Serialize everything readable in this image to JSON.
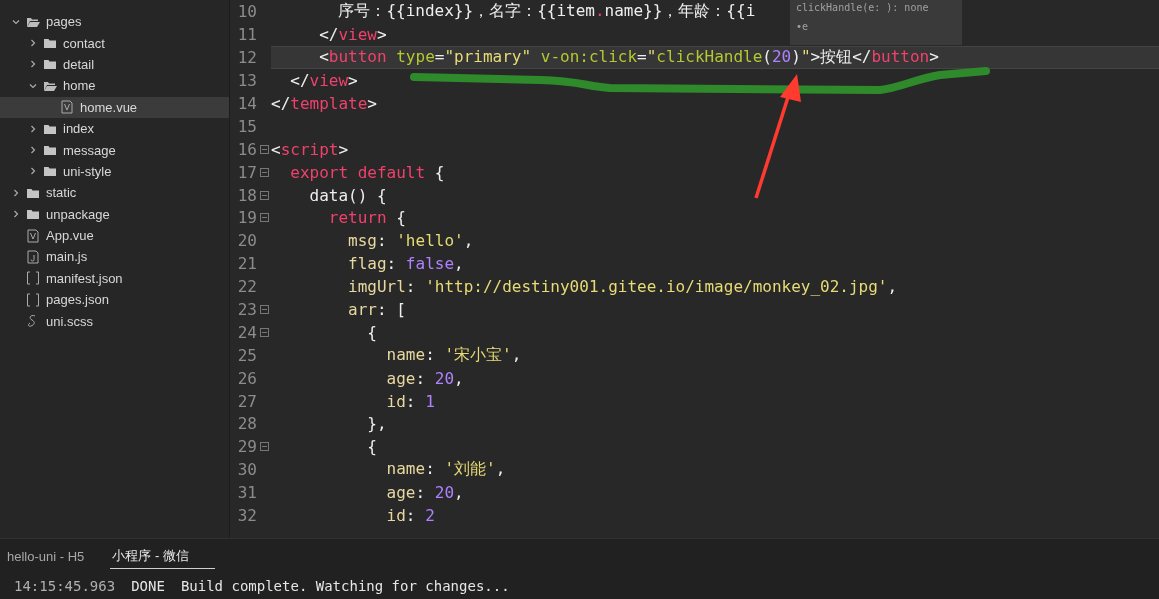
{
  "sidebar": {
    "tree": [
      {
        "name": "pages",
        "kind": "folder",
        "expanded": true,
        "selected": false,
        "children": [
          {
            "name": "contact",
            "kind": "folder",
            "expanded": false,
            "selected": false
          },
          {
            "name": "detail",
            "kind": "folder",
            "expanded": false,
            "selected": false
          },
          {
            "name": "home",
            "kind": "folder",
            "expanded": true,
            "selected": false,
            "children": [
              {
                "name": "home.vue",
                "kind": "vue",
                "selected": true
              }
            ]
          },
          {
            "name": "index",
            "kind": "folder",
            "expanded": false,
            "selected": false
          },
          {
            "name": "message",
            "kind": "folder",
            "expanded": false,
            "selected": false
          },
          {
            "name": "uni-style",
            "kind": "folder",
            "expanded": false,
            "selected": false
          }
        ]
      },
      {
        "name": "static",
        "kind": "folder",
        "expanded": false,
        "selected": false
      },
      {
        "name": "unpackage",
        "kind": "folder",
        "expanded": false,
        "selected": false
      },
      {
        "name": "App.vue",
        "kind": "vue",
        "selected": false
      },
      {
        "name": "main.js",
        "kind": "js",
        "selected": false
      },
      {
        "name": "manifest.json",
        "kind": "json",
        "selected": false
      },
      {
        "name": "pages.json",
        "kind": "json",
        "selected": false
      },
      {
        "name": "uni.scss",
        "kind": "scss",
        "selected": false
      }
    ]
  },
  "editor": {
    "lines": [
      {
        "number": "10",
        "fold": false,
        "current": false,
        "tokens": [
          {
            "kind": "plain",
            "text": "       序号：{{index}}，名字：{{item"
          },
          {
            "kind": "tag",
            "text": "."
          },
          {
            "kind": "plain",
            "text": "name}}，年龄：{{i"
          }
        ]
      },
      {
        "number": "11",
        "fold": false,
        "current": false,
        "tokens": [
          {
            "kind": "plain",
            "text": "     </"
          },
          {
            "kind": "tag",
            "text": "view"
          },
          {
            "kind": "plain",
            "text": ">"
          }
        ]
      },
      {
        "number": "12",
        "fold": false,
        "current": true,
        "tokens": [
          {
            "kind": "plain",
            "text": "     <"
          },
          {
            "kind": "tag",
            "text": "button"
          },
          {
            "kind": "attr",
            "text": " type"
          },
          {
            "kind": "plain",
            "text": "="
          },
          {
            "kind": "str",
            "text": "\"primary\""
          },
          {
            "kind": "attr",
            "text": " v-on:click"
          },
          {
            "kind": "plain",
            "text": "="
          },
          {
            "kind": "str",
            "text": "\""
          },
          {
            "kind": "attr",
            "text": "clickHandle"
          },
          {
            "kind": "plain",
            "text": "("
          },
          {
            "kind": "num",
            "text": "20"
          },
          {
            "kind": "plain",
            "text": ")"
          },
          {
            "kind": "str",
            "text": "\""
          },
          {
            "kind": "plain",
            "text": ">按钮</"
          },
          {
            "kind": "tag",
            "text": "button"
          },
          {
            "kind": "plain",
            "text": ">"
          }
        ]
      },
      {
        "number": "13",
        "fold": false,
        "current": false,
        "tokens": [
          {
            "kind": "plain",
            "text": "  </"
          },
          {
            "kind": "tag",
            "text": "view"
          },
          {
            "kind": "plain",
            "text": ">"
          }
        ]
      },
      {
        "number": "14",
        "fold": false,
        "current": false,
        "tokens": [
          {
            "kind": "plain",
            "text": "</"
          },
          {
            "kind": "tag",
            "text": "template"
          },
          {
            "kind": "plain",
            "text": ">"
          }
        ]
      },
      {
        "number": "15",
        "fold": false,
        "current": false
      },
      {
        "number": "16",
        "fold": true,
        "current": false,
        "tokens": [
          {
            "kind": "plain",
            "text": "<"
          },
          {
            "kind": "tag",
            "text": "script"
          },
          {
            "kind": "plain",
            "text": ">"
          }
        ]
      },
      {
        "number": "17",
        "fold": true,
        "current": false,
        "tokens": [
          {
            "kind": "tag",
            "text": "  export default"
          },
          {
            "kind": "plain",
            "text": " {"
          }
        ]
      },
      {
        "number": "18",
        "fold": true,
        "current": false,
        "tokens": [
          {
            "kind": "plain",
            "text": "    data() {"
          }
        ]
      },
      {
        "number": "19",
        "fold": true,
        "current": false,
        "tokens": [
          {
            "kind": "tag",
            "text": "      return"
          },
          {
            "kind": "plain",
            "text": " {"
          }
        ]
      },
      {
        "number": "20",
        "fold": false,
        "current": false,
        "tokens": [
          {
            "kind": "prop",
            "text": "        msg"
          },
          {
            "kind": "plain",
            "text": ": "
          },
          {
            "kind": "str",
            "text": "'hello'"
          },
          {
            "kind": "plain",
            "text": ","
          }
        ]
      },
      {
        "number": "21",
        "fold": false,
        "current": false,
        "tokens": [
          {
            "kind": "prop",
            "text": "        flag"
          },
          {
            "kind": "plain",
            "text": ": "
          },
          {
            "kind": "num",
            "text": "false"
          },
          {
            "kind": "plain",
            "text": ","
          }
        ]
      },
      {
        "number": "22",
        "fold": false,
        "current": false,
        "tokens": [
          {
            "kind": "prop",
            "text": "        imgUrl"
          },
          {
            "kind": "plain",
            "text": ": "
          },
          {
            "kind": "str",
            "text": "'http://destiny001.gitee.io/image/monkey_02.jpg'"
          },
          {
            "kind": "plain",
            "text": ","
          }
        ]
      },
      {
        "number": "23",
        "fold": true,
        "current": false,
        "tokens": [
          {
            "kind": "prop",
            "text": "        arr"
          },
          {
            "kind": "plain",
            "text": ": ["
          }
        ]
      },
      {
        "number": "24",
        "fold": true,
        "current": false,
        "tokens": [
          {
            "kind": "plain",
            "text": "          {"
          }
        ]
      },
      {
        "number": "25",
        "fold": false,
        "current": false,
        "tokens": [
          {
            "kind": "prop",
            "text": "            name"
          },
          {
            "kind": "plain",
            "text": ": "
          },
          {
            "kind": "str",
            "text": "'宋小宝'"
          },
          {
            "kind": "plain",
            "text": ","
          }
        ]
      },
      {
        "number": "26",
        "fold": false,
        "current": false,
        "tokens": [
          {
            "kind": "prop",
            "text": "            age"
          },
          {
            "kind": "plain",
            "text": ": "
          },
          {
            "kind": "num",
            "text": "20"
          },
          {
            "kind": "plain",
            "text": ","
          }
        ]
      },
      {
        "number": "27",
        "fold": false,
        "current": false,
        "tokens": [
          {
            "kind": "prop",
            "text": "            id"
          },
          {
            "kind": "plain",
            "text": ": "
          },
          {
            "kind": "num",
            "text": "1"
          }
        ]
      },
      {
        "number": "28",
        "fold": false,
        "current": false,
        "tokens": [
          {
            "kind": "plain",
            "text": "          },"
          }
        ]
      },
      {
        "number": "29",
        "fold": true,
        "current": false,
        "tokens": [
          {
            "kind": "plain",
            "text": "          {"
          }
        ]
      },
      {
        "number": "30",
        "fold": false,
        "current": false,
        "tokens": [
          {
            "kind": "prop",
            "text": "            name"
          },
          {
            "kind": "plain",
            "text": ": "
          },
          {
            "kind": "str",
            "text": "'刘能'"
          },
          {
            "kind": "plain",
            "text": ","
          }
        ]
      },
      {
        "number": "31",
        "fold": false,
        "current": false,
        "tokens": [
          {
            "kind": "prop",
            "text": "            age"
          },
          {
            "kind": "plain",
            "text": ": "
          },
          {
            "kind": "num",
            "text": "20"
          },
          {
            "kind": "plain",
            "text": ","
          }
        ]
      },
      {
        "number": "32",
        "fold": false,
        "current": false,
        "tokens": [
          {
            "kind": "prop",
            "text": "            id"
          },
          {
            "kind": "plain",
            "text": ": "
          },
          {
            "kind": "num",
            "text": "2"
          }
        ]
      }
    ],
    "tooltip": {
      "signature": "clickHandle(e: ): none",
      "param": "•e"
    }
  },
  "panel": {
    "tabs": [
      {
        "label": "hello-uni - H5",
        "selected": false
      },
      {
        "label": "小程序 - 微信",
        "selected": true
      }
    ],
    "log": {
      "time": "14:15:45.963",
      "status": "DONE",
      "message": "Build complete. Watching for changes..."
    }
  }
}
